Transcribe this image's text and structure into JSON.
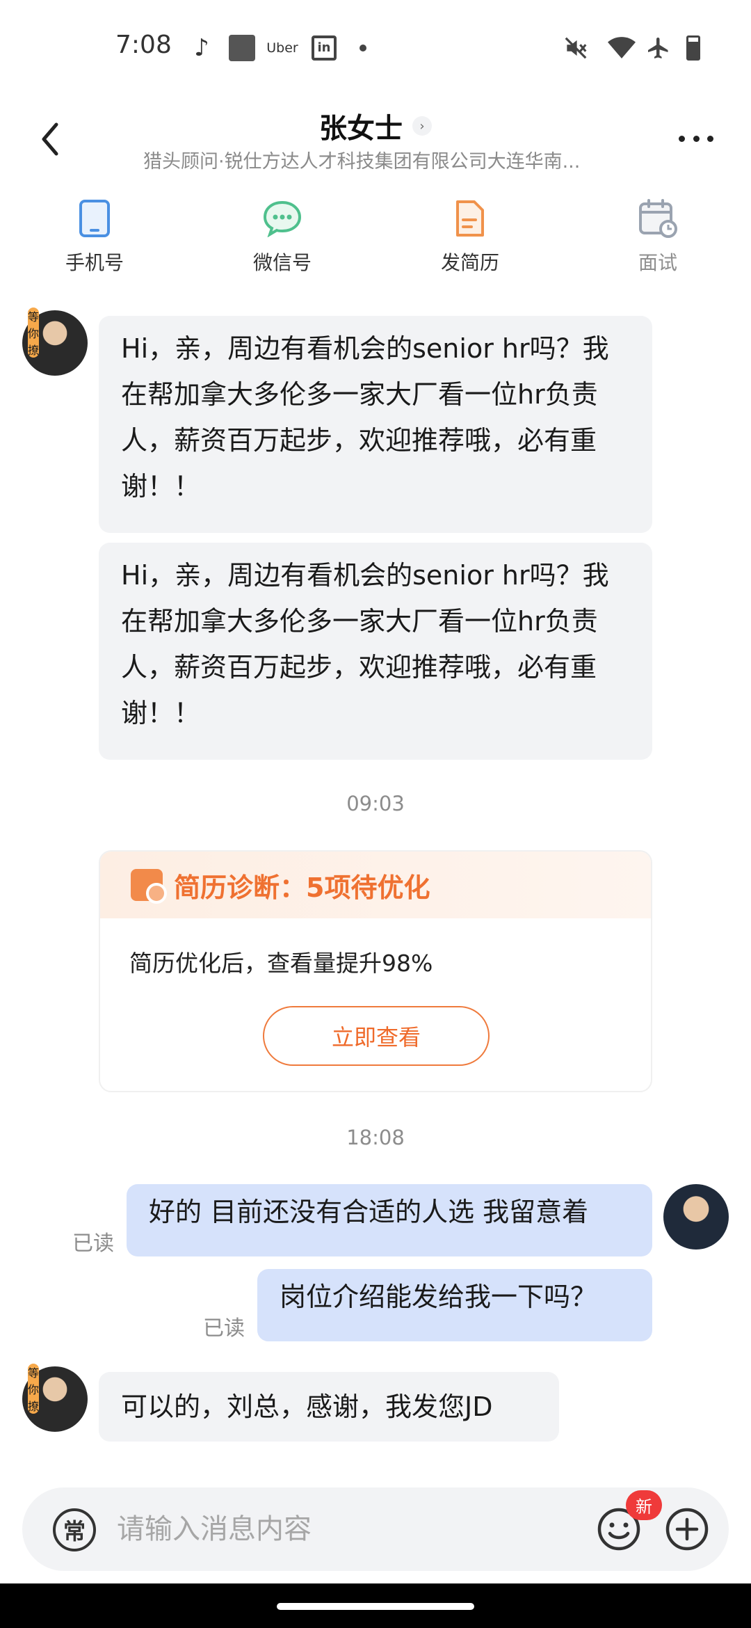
{
  "status_bar": {
    "time": "7:08",
    "uber_label": "Uber",
    "linkedin_label": "in"
  },
  "header": {
    "title": "张女士",
    "subtitle": "猎头顾问·锐仕方达人才科技集团有限公司大连华南...",
    "chevron": "›"
  },
  "actions": [
    {
      "label": "手机号",
      "icon": "phone-icon"
    },
    {
      "label": "微信号",
      "icon": "wechat-icon"
    },
    {
      "label": "发简历",
      "icon": "resume-icon"
    },
    {
      "label": "面试",
      "icon": "calendar-icon"
    }
  ],
  "contact": {
    "avatar_badge": "等你撩"
  },
  "messages": {
    "in1": "Hi，亲，周边有看机会的senior hr吗？我在帮加拿大多伦多一家大厂看一位hr负责人，薪资百万起步，欢迎推荐哦，必有重谢！！",
    "in2": "Hi，亲，周边有看机会的senior hr吗？我在帮加拿大多伦多一家大厂看一位hr负责人，薪资百万起步，欢迎推荐哦，必有重谢！！",
    "time1": "09:03",
    "time2": "18:08",
    "out1": "好的 目前还没有合适的人选 我留意着",
    "out2": "岗位介绍能发给我一下吗？",
    "read_label": "已读",
    "in3": "可以的，刘总，感谢，我发您JD"
  },
  "resume_card": {
    "title": "简历诊断：5项待优化",
    "body": "简历优化后，查看量提升98%",
    "button": "立即查看"
  },
  "input": {
    "common_phrases": "常",
    "placeholder": "请输入消息内容",
    "new_badge": "新"
  },
  "colors": {
    "accent_orange": "#ef7131",
    "outgoing_bubble": "#d6e2fb",
    "incoming_bubble": "#f2f3f5",
    "wechat_green": "#4fc08d",
    "phone_blue": "#4a90e2"
  }
}
